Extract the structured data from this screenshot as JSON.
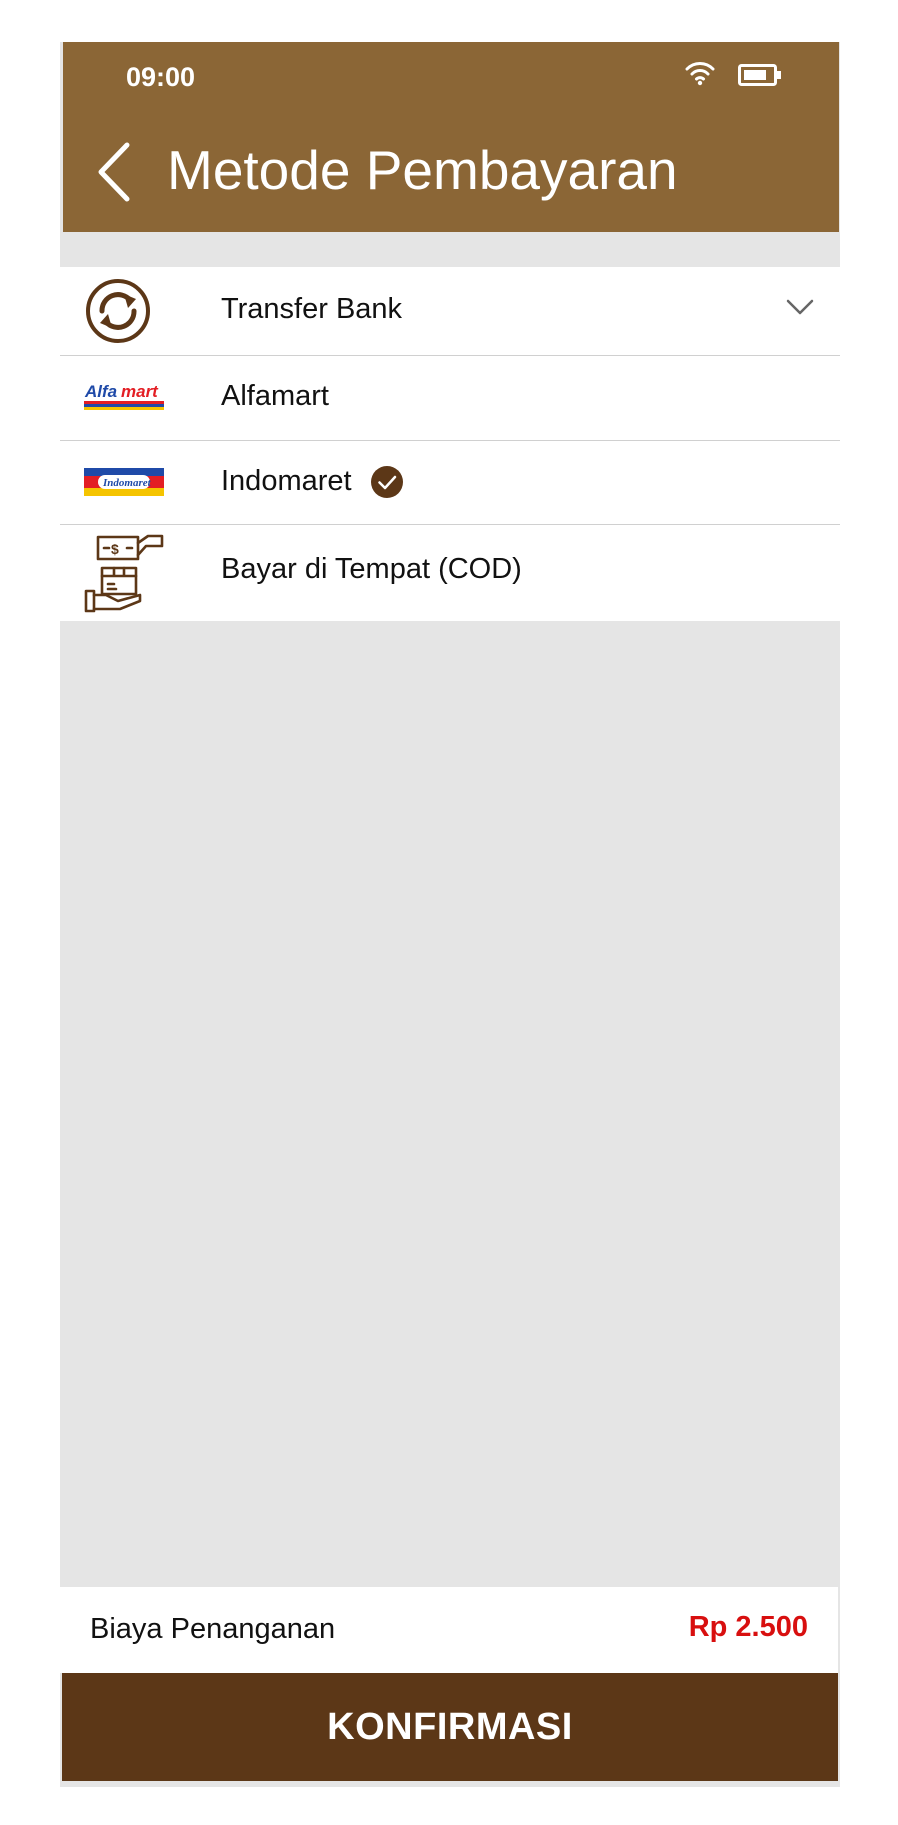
{
  "status_bar": {
    "time": "09:00",
    "icons": [
      "wifi-icon",
      "battery-icon"
    ]
  },
  "header": {
    "title": "Metode Pembayaran",
    "back_icon": "chevron-left-icon"
  },
  "payment_methods": [
    {
      "label": "Transfer Bank",
      "icon": "transfer-refresh-icon",
      "expandable": true
    },
    {
      "label": "Alfamart",
      "icon": "alfamart-logo"
    },
    {
      "label": "Indomaret",
      "icon": "indomaret-logo",
      "selected": true
    },
    {
      "label": "Bayar di Tempat (COD)",
      "icon": "cash-on-delivery-icon"
    }
  ],
  "fee": {
    "label": "Biaya Penanganan",
    "value": "Rp 2.500"
  },
  "confirm_label": "KONFIRMASI",
  "colors": {
    "header": "#8b6636",
    "button": "#5c3717",
    "price": "#d80f0f",
    "check": "#5c3717"
  }
}
